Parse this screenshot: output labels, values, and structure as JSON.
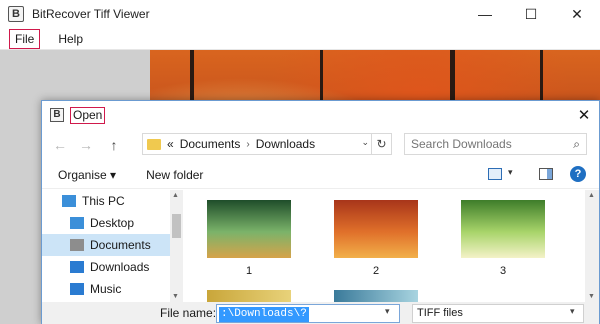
{
  "app": {
    "icon_letter": "B",
    "title": "BitRecover Tiff Viewer",
    "window_controls": {
      "minimize": "—",
      "maximize": "☐",
      "close": "✕"
    }
  },
  "menu": {
    "file": "File",
    "help": "Help"
  },
  "dialog": {
    "icon_letter": "B",
    "title": "Open",
    "close": "✕",
    "nav": {
      "back": "←",
      "forward": "→",
      "up": "↑"
    },
    "address": {
      "overflow": "«",
      "crumbs": [
        "Documents",
        "Downloads"
      ],
      "separator": "›",
      "dropdown": "⌄",
      "refresh": "↻"
    },
    "search": {
      "placeholder": "Search Downloads",
      "icon": "⌕"
    },
    "toolbar": {
      "organise": "Organise ▾",
      "new_folder": "New folder",
      "view_dropdown": "▾",
      "help": "?"
    },
    "nav_pane": [
      {
        "label": "This PC",
        "icon": "monitor-icon",
        "color": "#3b8fd9",
        "indent": 0
      },
      {
        "label": "Desktop",
        "icon": "desktop-icon",
        "color": "#3b8fd9",
        "indent": 1
      },
      {
        "label": "Documents",
        "icon": "documents-icon",
        "color": "#8d8d8d",
        "indent": 1,
        "selected": true
      },
      {
        "label": "Downloads",
        "icon": "downloads-icon",
        "color": "#2a7bd1",
        "indent": 1
      },
      {
        "label": "Music",
        "icon": "music-icon",
        "color": "#2a7bd1",
        "indent": 1
      }
    ],
    "files": [
      {
        "label": "1",
        "colors": [
          "#1f4d2a",
          "#7bb36a",
          "#d6a34a"
        ]
      },
      {
        "label": "2",
        "colors": [
          "#a8351a",
          "#e0702a",
          "#f2b04a"
        ]
      },
      {
        "label": "3",
        "colors": [
          "#3e7d2a",
          "#a8d46a",
          "#f4f2c8"
        ]
      }
    ],
    "file_name_label": "File name:",
    "file_name_value": ":\\Downloads\\?",
    "file_type": "TIFF files"
  }
}
